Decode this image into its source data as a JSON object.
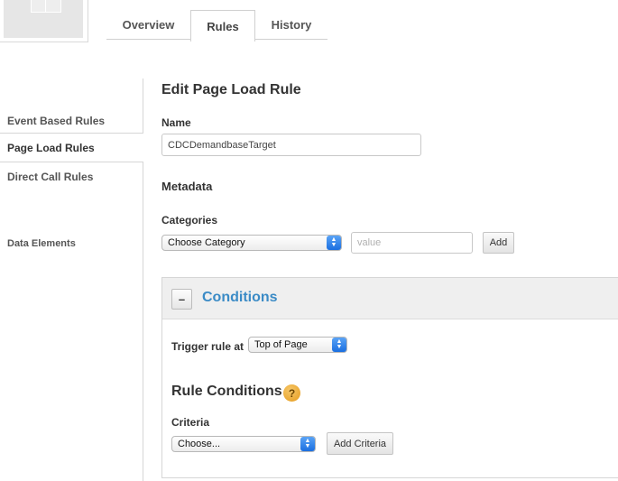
{
  "tabs": [
    {
      "label": "Overview"
    },
    {
      "label": "Rules",
      "active": true
    },
    {
      "label": "History"
    }
  ],
  "sidebar": {
    "items": [
      {
        "label": "Event Based Rules"
      },
      {
        "label": "Page Load Rules",
        "active": true
      },
      {
        "label": "Direct Call Rules"
      },
      {
        "label": "Data Elements"
      }
    ]
  },
  "editor": {
    "title": "Edit Page Load Rule",
    "name_label": "Name",
    "name_value": "CDCDemandbaseTarget",
    "metadata_heading": "Metadata",
    "categories_label": "Categories",
    "category_select": "Choose Category",
    "value_placeholder": "value",
    "add_label": "Add"
  },
  "conditions": {
    "collapse_symbol": "–",
    "title": "Conditions",
    "trigger_label": "Trigger rule at",
    "trigger_select": "Top of Page",
    "rule_conditions_heading": "Rule Conditions",
    "help_symbol": "?",
    "criteria_label": "Criteria",
    "criteria_select": "Choose...",
    "add_criteria_label": "Add Criteria"
  },
  "colors": {
    "accent": "#3b8bc6",
    "select_arrow": "#1b6fe0",
    "help_icon": "#e49a1c"
  },
  "icons": {
    "thumbnail": "page-thumbnail-icon",
    "collapse": "minus-icon",
    "help": "question-mark-icon",
    "select_arrow": "up-down-chevron-icon"
  }
}
